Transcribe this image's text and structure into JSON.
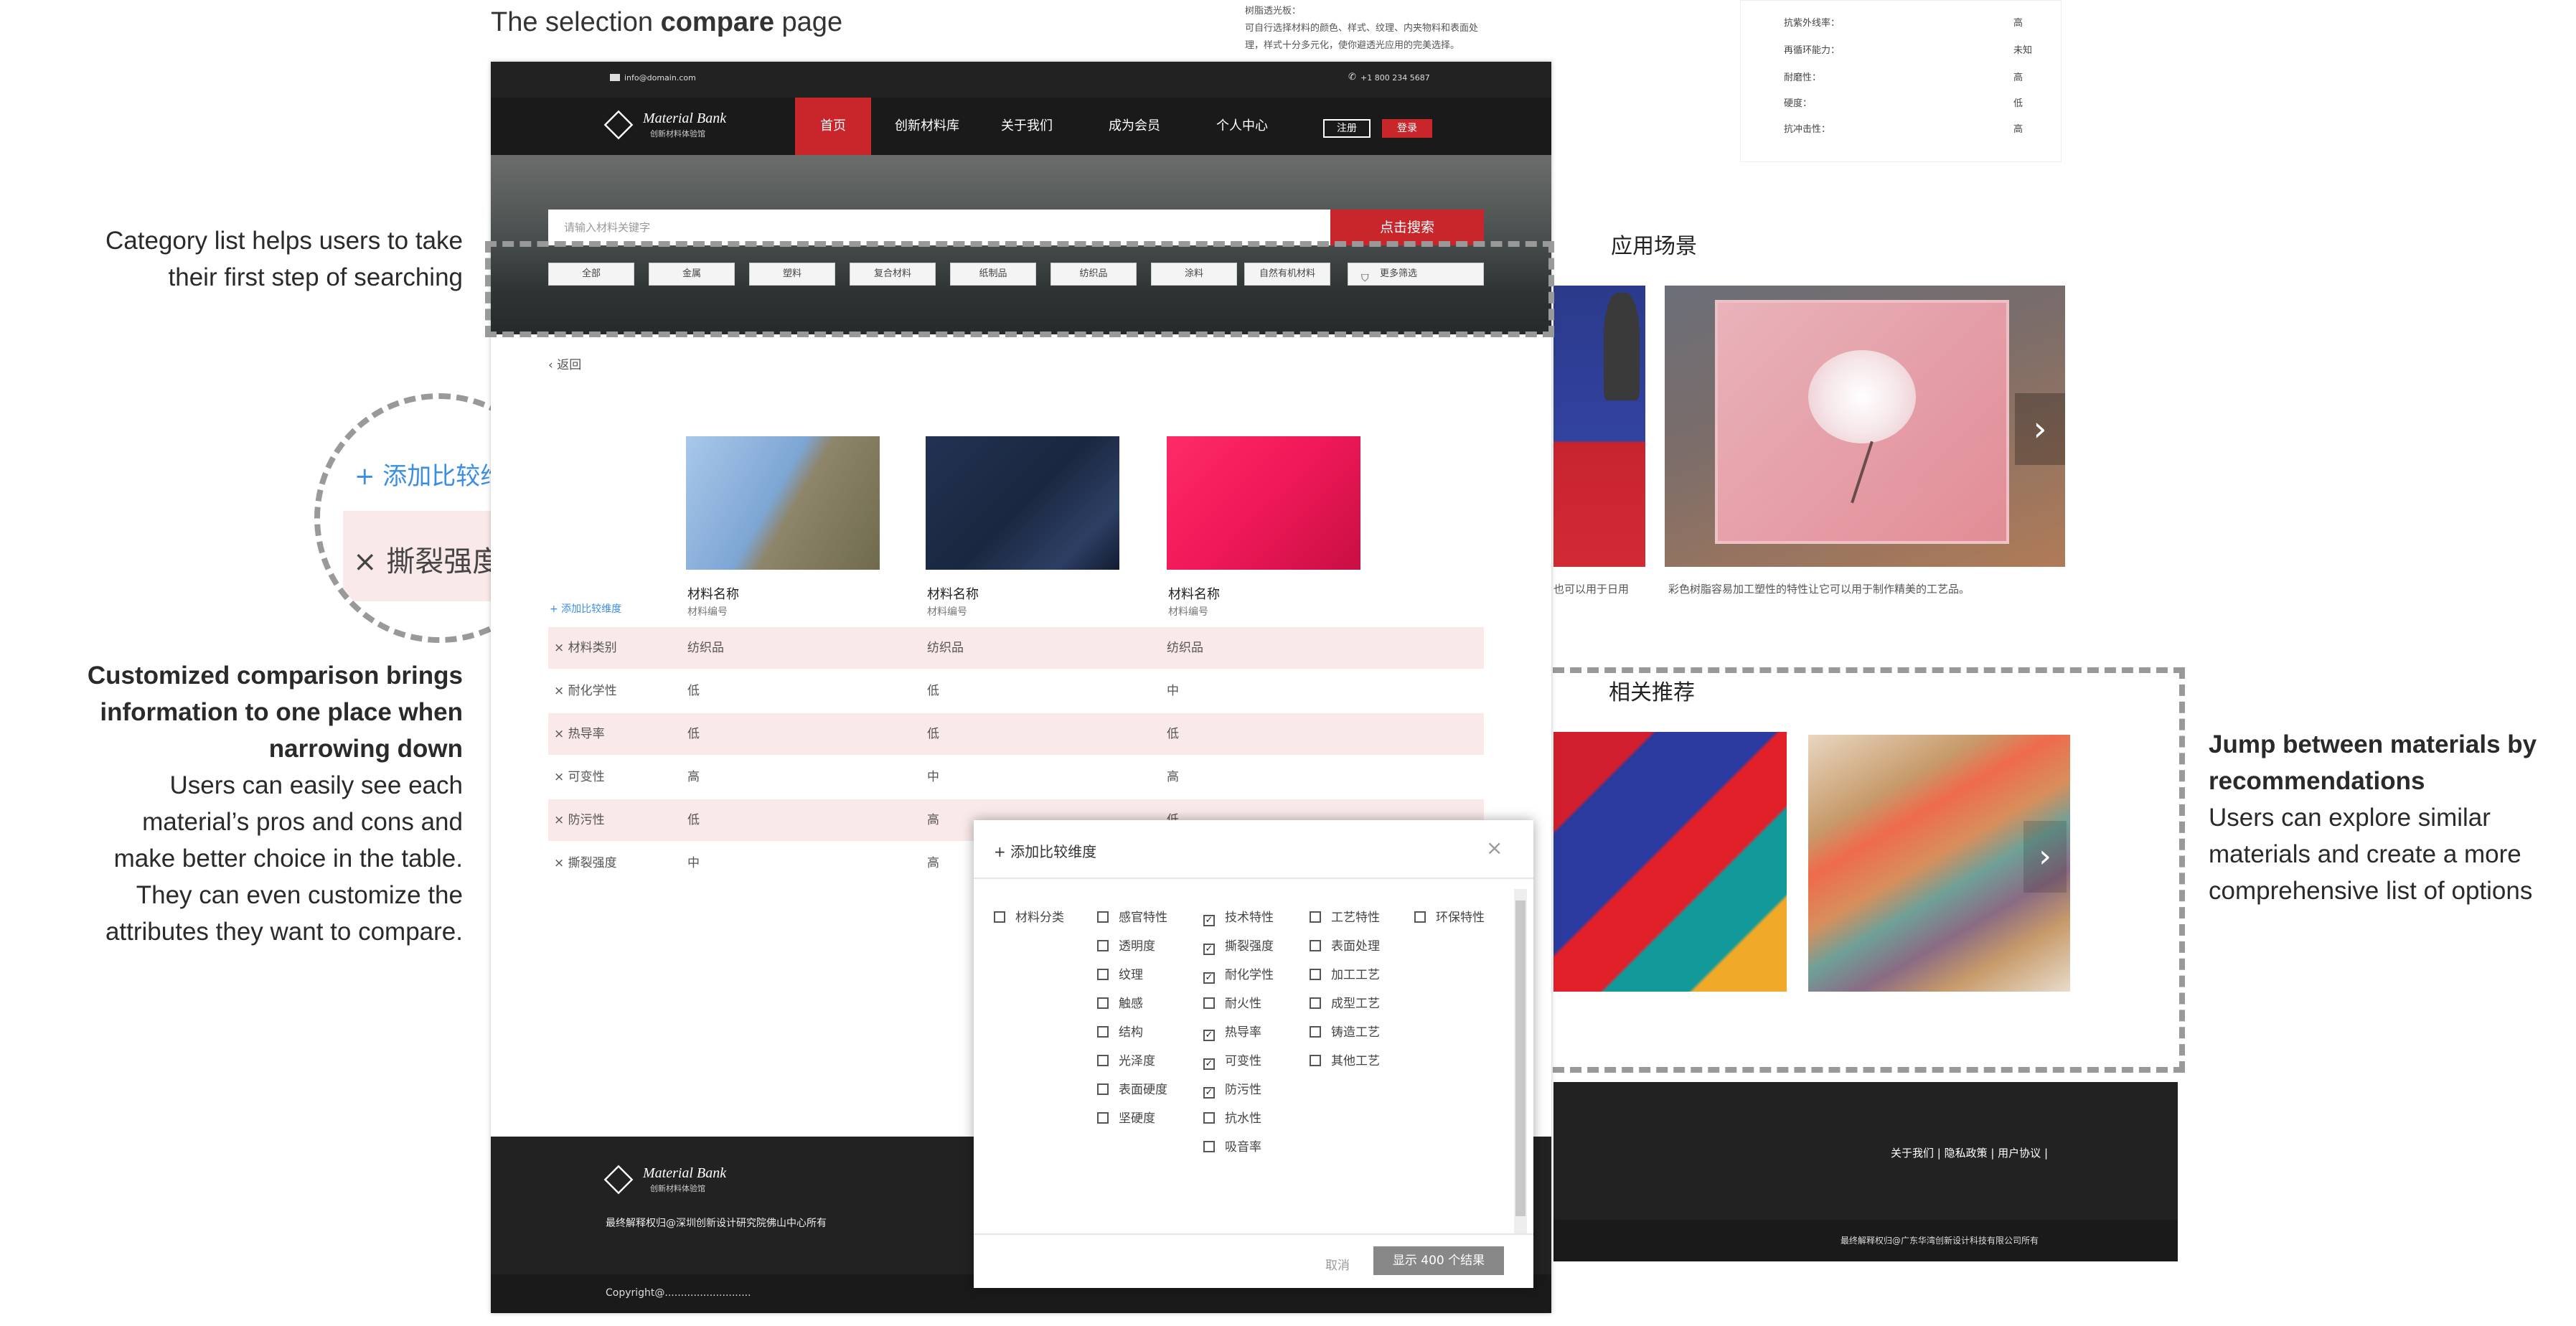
{
  "page_title_prefix": "The selection ",
  "page_title_bold": "compare",
  "page_title_suffix": " page",
  "annotations": {
    "category": [
      "Category list helps users to take",
      "their first step of searching"
    ],
    "custom_bold": [
      "Customized comparison brings",
      "information to one place when",
      "narrowing down"
    ],
    "custom_reg": [
      "Users can easily see each",
      "material’s pros and cons and",
      "make better choice in the table.",
      "They can even customize the",
      "attributes they want to compare."
    ],
    "jump_bold": [
      "Jump between materials by",
      "recommendations"
    ],
    "jump_reg": [
      "Users can explore similar",
      "materials and create a more",
      "comprehensive list of options"
    ]
  },
  "zoom": {
    "add_label": "+ 添加比较维度",
    "tear_label": "× 撕裂强度"
  },
  "site": {
    "email": "info@domain.com",
    "phone": "+1 800 234 5687",
    "logo_title": "Material Bank",
    "logo_sub": "创新材料体验馆",
    "nav": [
      "首页",
      "创新材料库",
      "关于我们",
      "成为会员",
      "个人中心"
    ],
    "register": "注册",
    "login": "登录"
  },
  "search": {
    "placeholder": "请输入材料关键字",
    "button": "点击搜索"
  },
  "categories": [
    "全部",
    "金属",
    "塑料",
    "复合材料",
    "纸制品",
    "纺织品",
    "涂料",
    "自然有机材料",
    "更多筛选"
  ],
  "back": "返回",
  "products": [
    {
      "name": "材料名称",
      "code": "材料编号",
      "color": "denim-cotton"
    },
    {
      "name": "材料名称",
      "code": "材料编号",
      "color": "navy-denim"
    },
    {
      "name": "材料名称",
      "code": "材料编号",
      "color": "magenta-fabric"
    }
  ],
  "add_dimension": "+ 添加比较维度",
  "rows": [
    {
      "label": "× 材料类别",
      "v": [
        "纺织品",
        "纺织品",
        "纺织品"
      ],
      "pink": true
    },
    {
      "label": "× 耐化学性",
      "v": [
        "低",
        "低",
        "中"
      ],
      "pink": false
    },
    {
      "label": "× 热导率",
      "v": [
        "低",
        "低",
        "低"
      ],
      "pink": true
    },
    {
      "label": "× 可变性",
      "v": [
        "高",
        "中",
        "高"
      ],
      "pink": false
    },
    {
      "label": "× 防污性",
      "v": [
        "低",
        "高",
        "低"
      ],
      "pink": true
    },
    {
      "label": "× 撕裂强度",
      "v": [
        "中",
        "高",
        ""
      ],
      "pink": false
    }
  ],
  "footer": {
    "logo_title": "Material Bank",
    "logo_sub": "创新材料体验馆",
    "copyright_note": "最终解释权归@深圳创新设计研究院佛山中心所有",
    "copyright": "Copyright@..........................."
  },
  "modal": {
    "title": "+ 添加比较维度",
    "close": "×",
    "col1": [
      {
        "t": "材料分类",
        "c": false
      }
    ],
    "col2": [
      {
        "t": "感官特性",
        "c": false
      },
      {
        "t": "透明度",
        "c": false
      },
      {
        "t": "纹理",
        "c": false
      },
      {
        "t": "触感",
        "c": false
      },
      {
        "t": "结构",
        "c": false
      },
      {
        "t": "光泽度",
        "c": false
      },
      {
        "t": "表面硬度",
        "c": false
      },
      {
        "t": "坚硬度",
        "c": false
      }
    ],
    "col3": [
      {
        "t": "技术特性",
        "c": true
      },
      {
        "t": "撕裂强度",
        "c": true
      },
      {
        "t": "耐化学性",
        "c": true
      },
      {
        "t": "耐火性",
        "c": false
      },
      {
        "t": "热导率",
        "c": true
      },
      {
        "t": "可变性",
        "c": true
      },
      {
        "t": "防污性",
        "c": true
      },
      {
        "t": "抗水性",
        "c": false
      },
      {
        "t": "吸音率",
        "c": false
      }
    ],
    "col4": [
      {
        "t": "工艺特性",
        "c": false
      },
      {
        "t": "表面处理",
        "c": false
      },
      {
        "t": "加工工艺",
        "c": false
      },
      {
        "t": "成型工艺",
        "c": false
      },
      {
        "t": "铸造工艺",
        "c": false
      },
      {
        "t": "其他工艺",
        "c": false
      }
    ],
    "col5": [
      {
        "t": "环保特性",
        "c": false
      }
    ],
    "cancel": "取消",
    "ok": "显示 400 个结果"
  },
  "specs": [
    {
      "k": "抗紫外线率：",
      "v": "高"
    },
    {
      "k": "再循环能力：",
      "v": "未知"
    },
    {
      "k": "耐磨性：",
      "v": "高"
    },
    {
      "k": "硬度：",
      "v": "低"
    },
    {
      "k": "抗冲击性：",
      "v": "高"
    }
  ],
  "top_text": [
    "树脂透光板：",
    "可自行选择材料的颜色、样式、纹理、内夹物料和表面处",
    "理，样式十分多元化，使你避透光应用的完美选择。"
  ],
  "scene_title": "应用场景",
  "scene_caption_left": "也可以用于日用",
  "scene_caption": "彩色树脂容易加工塑性的特性让它可以用于制作精美的工艺品。",
  "recommend_title": "相关推荐",
  "rfooter": {
    "links": "关于我们 | 隐私政策 | 用户协议 |",
    "note": "最终解释权归@广东华湾创新设计科技有限公司所有"
  },
  "colors": {
    "accent": "#c9262c",
    "link": "#3a8ee6",
    "pink_row": "#f9e9e9"
  }
}
